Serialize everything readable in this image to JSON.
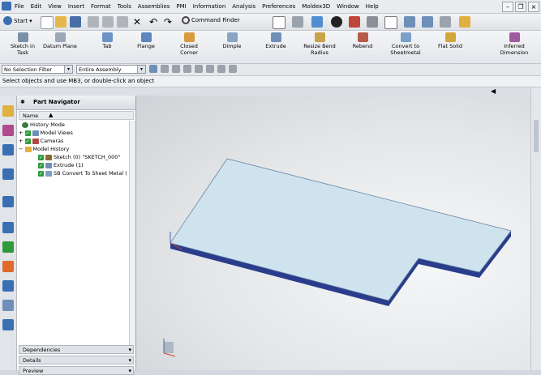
{
  "menubar": {
    "items": [
      "File",
      "Edit",
      "View",
      "Insert",
      "Format",
      "Tools",
      "Assemblies",
      "PMI",
      "Information",
      "Analysis",
      "Preferences",
      "Moldex3D",
      "Window",
      "Help"
    ]
  },
  "toolbar": {
    "start_label": "Start",
    "command_finder_label": "Command Finder"
  },
  "ribbon": {
    "buttons": [
      {
        "label1": "Sketch in",
        "label2": "Task",
        "color": "#7a8fa8"
      },
      {
        "label1": "Datum Plane",
        "label2": "",
        "color": "#9aa7b8"
      },
      {
        "label1": "Tab",
        "label2": "",
        "color": "#6c93c7"
      },
      {
        "label1": "Flange",
        "label2": "",
        "color": "#5d86c0"
      },
      {
        "label1": "Closed",
        "label2": "Corner",
        "color": "#d99b3f"
      },
      {
        "label1": "Dimple",
        "label2": "",
        "color": "#8aa4c4"
      },
      {
        "label1": "Extrude",
        "label2": "",
        "color": "#6f8fb6"
      },
      {
        "label1": "Resize Bend",
        "label2": "Radius",
        "color": "#c9a24b"
      },
      {
        "label1": "Rebend",
        "label2": "",
        "color": "#b75a4a"
      },
      {
        "label1": "Convert to",
        "label2": "Sheetmetal",
        "color": "#7aa0c8"
      },
      {
        "label1": "Flat Solid",
        "label2": "",
        "color": "#d3a63a"
      },
      {
        "label1": "Inferred",
        "label2": "Dimension",
        "color": "#a05aa0"
      }
    ]
  },
  "selection": {
    "filter_value": "No Selection Filter",
    "scope_value": "Entire Assembly"
  },
  "cue_line": "Select objects and use MB3, or double-click an object",
  "navigator": {
    "title": "Part Navigator",
    "column_header": "Name",
    "rows": [
      {
        "label": "History Mode",
        "indent": 0,
        "icon": "clock-icon",
        "check": false,
        "expander": ""
      },
      {
        "label": "Model Views",
        "indent": 0,
        "icon": "views-icon",
        "check": true,
        "expander": "+"
      },
      {
        "label": "Cameras",
        "indent": 0,
        "icon": "camera-icon",
        "check": true,
        "expander": "+"
      },
      {
        "label": "Model History",
        "indent": 0,
        "icon": "folder-icon",
        "check": false,
        "expander": "-"
      },
      {
        "label": "Sketch (0) \"SKETCH_000\"",
        "indent": 1,
        "icon": "sketch-icon",
        "check": true,
        "expander": ""
      },
      {
        "label": "Extrude (1)",
        "indent": 1,
        "icon": "extrude-icon",
        "check": true,
        "expander": ""
      },
      {
        "label": "SB Convert To Sheet Metal (",
        "indent": 1,
        "icon": "sheetmetal-icon",
        "check": true,
        "expander": ""
      }
    ],
    "panels": [
      "Dependencies",
      "Details",
      "Preview"
    ]
  },
  "colors": {
    "part_face": "#cfe3ee",
    "part_edge": "#2a3d8c",
    "accent": "#3a6fb3"
  }
}
